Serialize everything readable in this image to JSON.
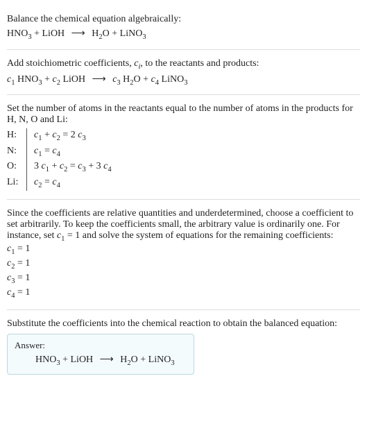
{
  "section1": {
    "title": "Balance the chemical equation algebraically:",
    "eq": {
      "r1": "HNO",
      "r1sub": "3",
      "r2": "LiOH",
      "p1": "H",
      "p1sub": "2",
      "p1b": "O",
      "p2": "LiNO",
      "p2sub": "3"
    }
  },
  "section2": {
    "title_a": "Add stoichiometric coefficients, ",
    "title_var": "c",
    "title_varsub": "i",
    "title_b": ", to the reactants and products:",
    "eq": {
      "c1": "c",
      "c1s": "1",
      "r1": "HNO",
      "r1s": "3",
      "c2": "c",
      "c2s": "2",
      "r2": "LiOH",
      "c3": "c",
      "c3s": "3",
      "p1a": "H",
      "p1as": "2",
      "p1b": "O",
      "c4": "c",
      "c4s": "4",
      "p2": "LiNO",
      "p2s": "3"
    }
  },
  "section3": {
    "title": "Set the number of atoms in the reactants equal to the number of atoms in the products for H, N, O and Li:",
    "rows": {
      "H": {
        "label": "H:",
        "lhs_a": "c",
        "lhs_as": "1",
        "plus": " + ",
        "lhs_b": "c",
        "lhs_bs": "2",
        "eq": " = 2 ",
        "rhs_a": "c",
        "rhs_as": "3"
      },
      "N": {
        "label": "N:",
        "lhs_a": "c",
        "lhs_as": "1",
        "eq": " = ",
        "rhs_a": "c",
        "rhs_as": "4"
      },
      "O": {
        "label": "O:",
        "lhs_pre": "3 ",
        "lhs_a": "c",
        "lhs_as": "1",
        "plus": " + ",
        "lhs_b": "c",
        "lhs_bs": "2",
        "eq": " = ",
        "rhs_a": "c",
        "rhs_as": "3",
        "plus2": " + 3 ",
        "rhs_b": "c",
        "rhs_bs": "4"
      },
      "Li": {
        "label": "Li:",
        "lhs_a": "c",
        "lhs_as": "2",
        "eq": " = ",
        "rhs_a": "c",
        "rhs_as": "4"
      }
    }
  },
  "section4": {
    "text_a": "Since the coefficients are relative quantities and underdetermined, choose a coefficient to set arbitrarily. To keep the coefficients small, the arbitrary value is ordinarily one. For instance, set ",
    "var": "c",
    "varsub": "1",
    "text_b": " = 1 and solve the system of equations for the remaining coefficients:",
    "lines": {
      "l1": {
        "v": "c",
        "s": "1",
        "rhs": " = 1"
      },
      "l2": {
        "v": "c",
        "s": "2",
        "rhs": " = 1"
      },
      "l3": {
        "v": "c",
        "s": "3",
        "rhs": " = 1"
      },
      "l4": {
        "v": "c",
        "s": "4",
        "rhs": " = 1"
      }
    }
  },
  "section5": {
    "title": "Substitute the coefficients into the chemical reaction to obtain the balanced equation:",
    "answer_label": "Answer:",
    "eq": {
      "r1": "HNO",
      "r1sub": "3",
      "r2": "LiOH",
      "p1": "H",
      "p1sub": "2",
      "p1b": "O",
      "p2": "LiNO",
      "p2sub": "3"
    }
  },
  "arrow": "⟶"
}
